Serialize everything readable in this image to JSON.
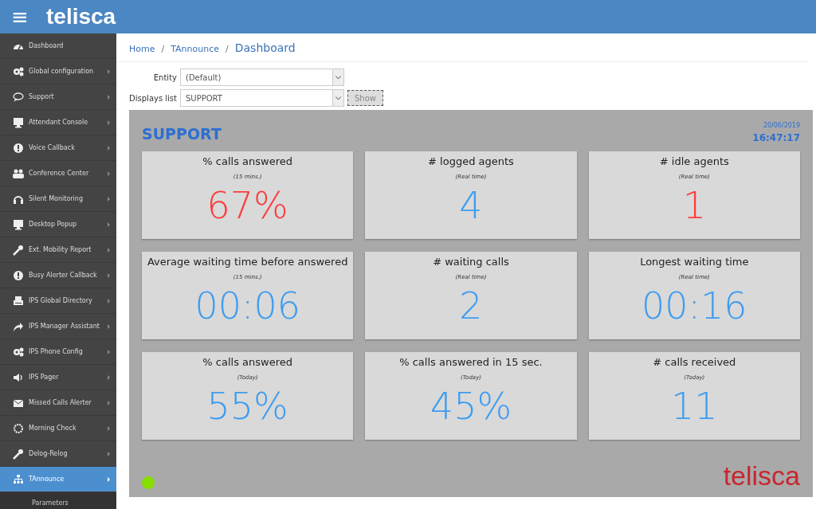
{
  "header": {
    "menu_glyph": "≡",
    "logo": "telisca"
  },
  "sidebar": {
    "items": [
      {
        "label": "Dashboard",
        "kind": "link",
        "selected": false
      },
      {
        "label": "Global configuration",
        "kind": "menu",
        "selected": false
      },
      {
        "label": "Support",
        "kind": "menu",
        "selected": false
      },
      {
        "label": "Attendant Console",
        "kind": "menu",
        "selected": false
      },
      {
        "label": "Voice Callback",
        "kind": "menu",
        "selected": false
      },
      {
        "label": "Conference Center",
        "kind": "menu",
        "selected": false
      },
      {
        "label": "Silent Monitoring",
        "kind": "menu",
        "selected": false
      },
      {
        "label": "Desktop Popup",
        "kind": "menu",
        "selected": false
      },
      {
        "label": "Ext. Mobility Report",
        "kind": "menu",
        "selected": false
      },
      {
        "label": "Busy Alerter Callback",
        "kind": "menu",
        "selected": false
      },
      {
        "label": "IPS Global Directory",
        "kind": "menu",
        "selected": false
      },
      {
        "label": "IPS Manager Assistant",
        "kind": "menu",
        "selected": false
      },
      {
        "label": "IPS Phone Config",
        "kind": "menu",
        "selected": false
      },
      {
        "label": "IPS Pager",
        "kind": "menu",
        "selected": false
      },
      {
        "label": "Missed Calls Alerter",
        "kind": "menu",
        "selected": false
      },
      {
        "label": "Morning Check",
        "kind": "menu",
        "selected": false
      },
      {
        "label": "Delog-Relog",
        "kind": "menu",
        "selected": false
      },
      {
        "label": "TAnnounce",
        "kind": "menu",
        "selected": true,
        "children": [
          {
            "label": "Parameters"
          }
        ]
      }
    ]
  },
  "breadcrumb": [
    "Home",
    "TAnnounce",
    "Dashboard"
  ],
  "breadcrumb_separators": [
    "/",
    "/"
  ],
  "filters": [
    {
      "label": "Entity",
      "value": "(Default)"
    },
    {
      "label": "Displays list",
      "value": "SUPPORT"
    }
  ],
  "show_button": "Show",
  "panel": {
    "title": "SUPPORT",
    "date": "20/06/2019",
    "time": "16:47:17",
    "tiles": [
      {
        "title": "% calls answered",
        "period": "(15 mins.)",
        "value": "67%",
        "color": "#ff3b3b"
      },
      {
        "title": "# logged agents",
        "period": "(Real time)",
        "value": "4",
        "color": "#3d9cf0"
      },
      {
        "title": "# idle agents",
        "period": "(Real time)",
        "value": "1",
        "color": "#ff3b3b"
      },
      {
        "title": "Average waiting time before answered",
        "period": "(15 mins.)",
        "value": "00:06",
        "color": "#3d9cf0"
      },
      {
        "title": "# waiting calls",
        "period": "(Real time)",
        "value": "2",
        "color": "#3d9cf0"
      },
      {
        "title": "Longest waiting time",
        "period": "(Real time)",
        "value": "00:16",
        "color": "#3d9cf0"
      },
      {
        "title": "% calls answered",
        "period": "(Today)",
        "value": "55%",
        "color": "#3d9cf0"
      },
      {
        "title": "% calls answered in 15 sec.",
        "period": "(Today)",
        "value": "45%",
        "color": "#3d9cf0"
      },
      {
        "title": "# calls received",
        "period": "(Today)",
        "value": "11",
        "color": "#3d9cf0"
      }
    ],
    "status_on": true,
    "logo": "telisca"
  }
}
